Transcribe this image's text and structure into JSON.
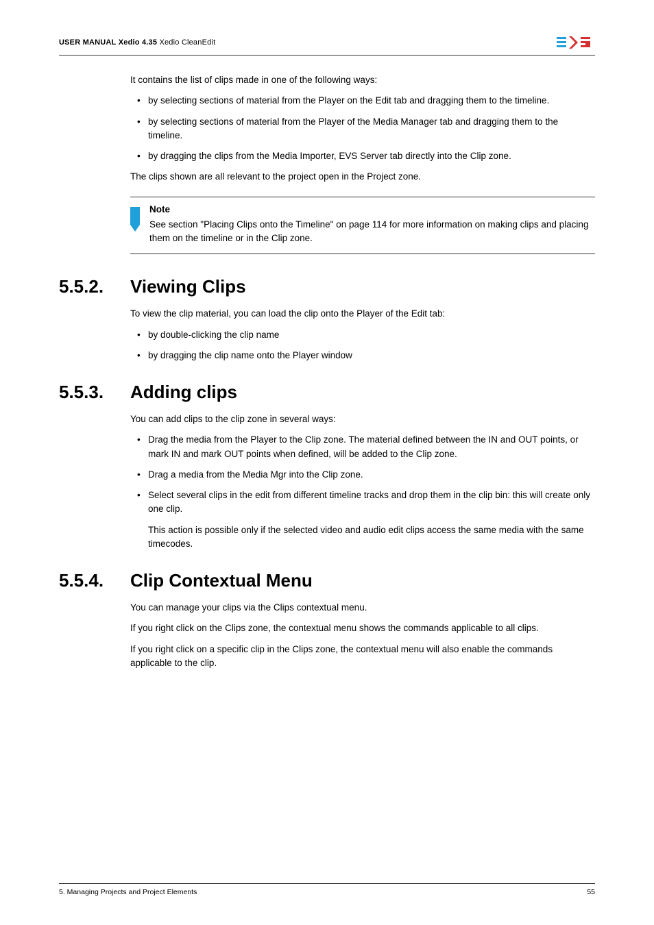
{
  "header": {
    "manual_prefix": "USER MANUAL",
    "product": "Xedio 4.35",
    "module": "Xedio CleanEdit"
  },
  "intro": {
    "lead": "It contains the list of clips made in one of the following ways:",
    "items": [
      "by selecting sections of material from the Player on the Edit tab and dragging them to the timeline.",
      "by selecting sections of material from the Player of the Media Manager tab and dragging them to the timeline.",
      "by dragging the clips from the Media Importer, EVS Server tab directly into the Clip zone."
    ],
    "closing": "The clips shown are all relevant to the project open in the Project zone."
  },
  "note": {
    "label": "Note",
    "text": "See section \"Placing Clips onto the Timeline\" on page 114 for more information on making clips and placing them on the timeline or in the Clip zone."
  },
  "s552": {
    "num": "5.5.2.",
    "title": "Viewing Clips",
    "lead": "To view the clip material, you can load the clip onto the Player of the Edit tab:",
    "items": [
      "by double-clicking the clip name",
      "by dragging the clip name onto the Player window"
    ]
  },
  "s553": {
    "num": "5.5.3.",
    "title": "Adding clips",
    "lead": "You can add clips to the clip zone in several ways:",
    "items": [
      "Drag the media from the Player to the Clip zone. The material defined between the IN and OUT points, or mark IN and mark OUT points when defined, will be added to the Clip zone.",
      "Drag a media from the Media Mgr into the Clip zone.",
      "Select several clips in the edit from different timeline tracks and drop them in the clip bin: this will create only one clip."
    ],
    "note_below": "This action is possible only if the selected video and audio edit clips access the same media with the same timecodes."
  },
  "s554": {
    "num": "5.5.4.",
    "title": "Clip Contextual Menu",
    "p1": "You can manage your clips via the Clips contextual menu.",
    "p2": "If you right click on the Clips zone, the contextual menu shows the commands applicable to all clips.",
    "p3": "If you right click on a specific clip in the Clips zone, the contextual menu will also enable the commands applicable to the clip."
  },
  "footer": {
    "left": "5. Managing Projects and Project Elements",
    "right": "55"
  }
}
